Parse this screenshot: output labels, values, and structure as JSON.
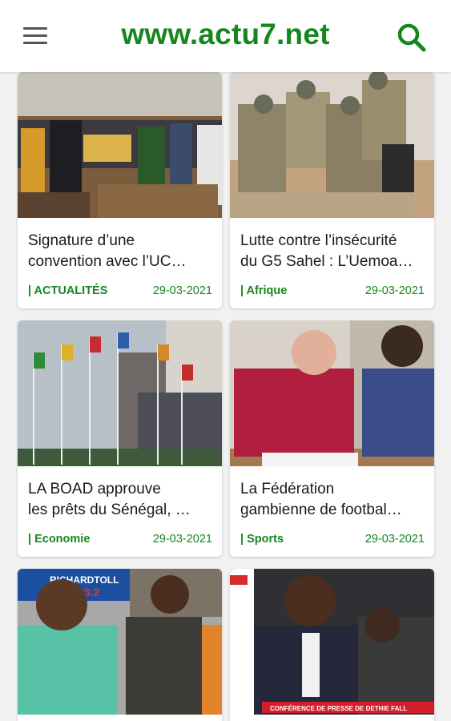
{
  "header": {
    "title": "www.actu7.net",
    "menu_icon": "hamburger-menu-icon",
    "search_icon": "search-icon",
    "accent": "#16871f"
  },
  "articles": [
    {
      "title": "Signature d’une\nconvention avec l’UC…",
      "category": "| ACTUALITÉS",
      "date": "29-03-2021"
    },
    {
      "title": "Lutte contre l’insécurité\ndu G5 Sahel : L’Uemoa…",
      "category": "| Afrique",
      "date": "29-03-2021"
    },
    {
      "title": "LA BOAD approuve\nles prêts du Sénégal, …",
      "category": "| Economie",
      "date": "29-03-2021"
    },
    {
      "title": "La Fédération\ngambienne de footbal…",
      "category": "| Sports",
      "date": "29-03-2021"
    },
    {
      "title": "",
      "category": "",
      "date": "",
      "image_text": [
        "RICHARDTOLL",
        "93.2"
      ]
    },
    {
      "title": "",
      "category": "",
      "date": "",
      "image_text": [
        "CONFÉRENCE DE PRESSE DE DETHIE FALL"
      ]
    }
  ]
}
